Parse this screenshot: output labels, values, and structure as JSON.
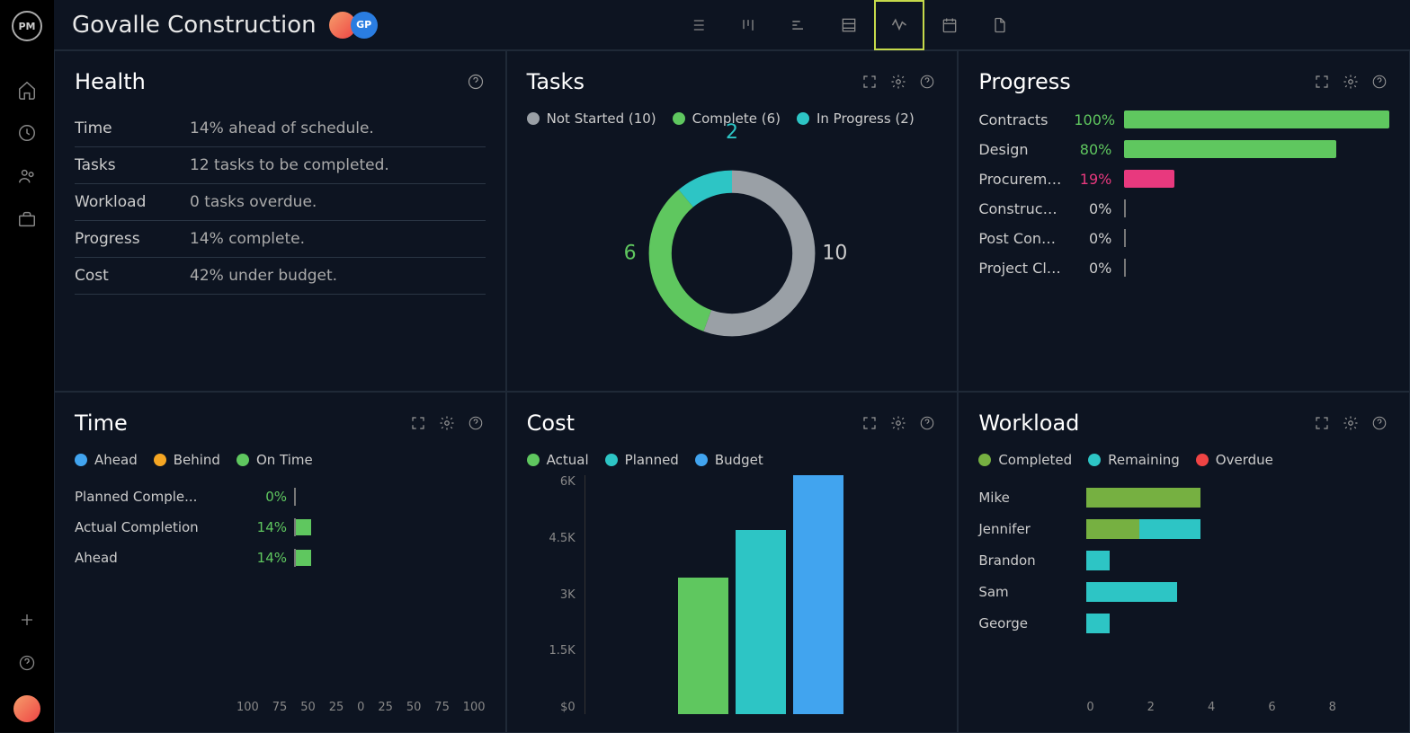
{
  "header": {
    "title": "Govalle Construction",
    "logo_text": "PM",
    "avatar_label": "GP"
  },
  "chart_data": [
    {
      "type": "pie",
      "title": "Tasks",
      "series": [
        {
          "name": "Not Started",
          "value": 10,
          "color": "#9aa0a6"
        },
        {
          "name": "Complete",
          "value": 6,
          "color": "#5fc75f"
        },
        {
          "name": "In Progress",
          "value": 2,
          "color": "#2dc5c5"
        }
      ]
    },
    {
      "type": "bar",
      "title": "Progress",
      "categories": [
        "Contracts",
        "Design",
        "Procurement",
        "Construction",
        "Post Const...",
        "Project Clo..."
      ],
      "values": [
        100,
        80,
        19,
        0,
        0,
        0
      ],
      "colors": [
        "#5fc75f",
        "#5fc75f",
        "#e8397e",
        "",
        "",
        ""
      ],
      "ylim": [
        0,
        100
      ]
    },
    {
      "type": "bar",
      "title": "Time",
      "categories": [
        "Planned Comple...",
        "Actual Completion",
        "Ahead"
      ],
      "values": [
        0,
        14,
        14
      ],
      "xlim": [
        -100,
        100
      ],
      "xticks": [
        100,
        75,
        50,
        25,
        0,
        25,
        50,
        75,
        100
      ]
    },
    {
      "type": "bar",
      "title": "Cost",
      "categories": [
        "Actual",
        "Planned",
        "Budget"
      ],
      "values": [
        3400,
        4600,
        6000
      ],
      "colors": [
        "#5fc75f",
        "#2dc5c5",
        "#41a4ef"
      ],
      "yticks": [
        "6K",
        "4.5K",
        "3K",
        "1.5K",
        "$0"
      ],
      "ylim": [
        0,
        6000
      ]
    },
    {
      "type": "bar",
      "title": "Workload",
      "categories": [
        "Mike",
        "Jennifer",
        "Brandon",
        "Sam",
        "George"
      ],
      "series": [
        {
          "name": "Completed",
          "color": "#76b041",
          "values": [
            3,
            1.4,
            0,
            0,
            0
          ]
        },
        {
          "name": "Remaining",
          "color": "#2dc5c5",
          "values": [
            0,
            1.6,
            0.6,
            2.4,
            0.6
          ]
        },
        {
          "name": "Overdue",
          "color": "#ef4444",
          "values": [
            0,
            0,
            0,
            0,
            0
          ]
        }
      ],
      "xticks": [
        0,
        2,
        4,
        6,
        8
      ]
    }
  ],
  "health": {
    "title": "Health",
    "rows": [
      {
        "label": "Time",
        "value": "14% ahead of schedule."
      },
      {
        "label": "Tasks",
        "value": "12 tasks to be completed."
      },
      {
        "label": "Workload",
        "value": "0 tasks overdue."
      },
      {
        "label": "Progress",
        "value": "14% complete."
      },
      {
        "label": "Cost",
        "value": "42% under budget."
      }
    ]
  },
  "tasks": {
    "title": "Tasks",
    "legend": [
      {
        "label": "Not Started (10)",
        "color": "#9aa0a6"
      },
      {
        "label": "Complete (6)",
        "color": "#5fc75f"
      },
      {
        "label": "In Progress (2)",
        "color": "#2dc5c5"
      }
    ],
    "donut_labels": {
      "top": "2",
      "left": "6",
      "right": "10"
    }
  },
  "progress": {
    "title": "Progress",
    "rows": [
      {
        "label": "Contracts",
        "pct": "100%",
        "width": 100,
        "color": "#5fc75f",
        "pct_color": "#5fc75f"
      },
      {
        "label": "Design",
        "pct": "80%",
        "width": 80,
        "color": "#5fc75f",
        "pct_color": "#5fc75f"
      },
      {
        "label": "Procurement",
        "pct": "19%",
        "width": 19,
        "color": "#e8397e",
        "pct_color": "#e8397e"
      },
      {
        "label": "Construction",
        "pct": "0%",
        "width": 0,
        "color": "",
        "pct_color": "#ccc"
      },
      {
        "label": "Post Const...",
        "pct": "0%",
        "width": 0,
        "color": "",
        "pct_color": "#ccc"
      },
      {
        "label": "Project Clo...",
        "pct": "0%",
        "width": 0,
        "color": "",
        "pct_color": "#ccc"
      }
    ]
  },
  "time": {
    "title": "Time",
    "legend": [
      {
        "label": "Ahead",
        "color": "#41a4ef"
      },
      {
        "label": "Behind",
        "color": "#f5a623"
      },
      {
        "label": "On Time",
        "color": "#5fc75f"
      }
    ],
    "rows": [
      {
        "label": "Planned Comple...",
        "pct": "0%",
        "width": 0
      },
      {
        "label": "Actual Completion",
        "pct": "14%",
        "width": 14
      },
      {
        "label": "Ahead",
        "pct": "14%",
        "width": 14
      }
    ],
    "axis": [
      "100",
      "75",
      "50",
      "25",
      "0",
      "25",
      "50",
      "75",
      "100"
    ]
  },
  "cost": {
    "title": "Cost",
    "legend": [
      {
        "label": "Actual",
        "color": "#5fc75f"
      },
      {
        "label": "Planned",
        "color": "#2dc5c5"
      },
      {
        "label": "Budget",
        "color": "#41a4ef"
      }
    ],
    "yticks": [
      "6K",
      "4.5K",
      "3K",
      "1.5K",
      "$0"
    ],
    "bars": [
      {
        "h": 57,
        "color": "#5fc75f"
      },
      {
        "h": 77,
        "color": "#2dc5c5"
      },
      {
        "h": 100,
        "color": "#41a4ef"
      }
    ]
  },
  "workload": {
    "title": "Workload",
    "legend": [
      {
        "label": "Completed",
        "color": "#76b041"
      },
      {
        "label": "Remaining",
        "color": "#2dc5c5"
      },
      {
        "label": "Overdue",
        "color": "#ef4444"
      }
    ],
    "rows": [
      {
        "label": "Mike",
        "segs": [
          {
            "w": 37.5,
            "color": "#76b041"
          }
        ]
      },
      {
        "label": "Jennifer",
        "segs": [
          {
            "w": 17.5,
            "color": "#76b041"
          },
          {
            "w": 20,
            "color": "#2dc5c5"
          }
        ]
      },
      {
        "label": "Brandon",
        "segs": [
          {
            "w": 7.5,
            "color": "#2dc5c5"
          }
        ]
      },
      {
        "label": "Sam",
        "segs": [
          {
            "w": 30,
            "color": "#2dc5c5"
          }
        ]
      },
      {
        "label": "George",
        "segs": [
          {
            "w": 7.5,
            "color": "#2dc5c5"
          }
        ]
      }
    ],
    "axis": [
      "0",
      "2",
      "4",
      "6",
      "8"
    ]
  }
}
